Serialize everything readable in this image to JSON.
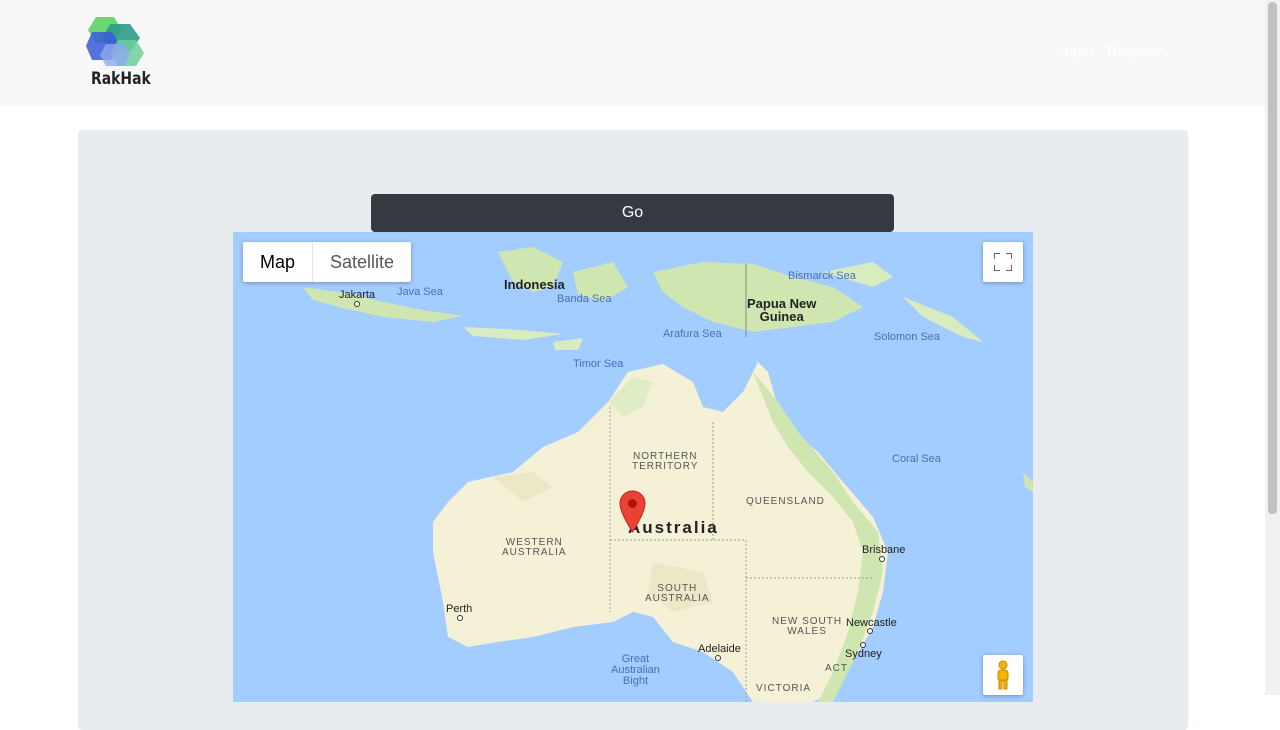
{
  "header": {
    "logo_text": "RakHak",
    "nav": {
      "login": "Login",
      "register": "Register"
    }
  },
  "form": {
    "go_label": "Go"
  },
  "map": {
    "type_controls": {
      "map": "Map",
      "satellite": "Satellite"
    },
    "labels": {
      "indonesia": "Indonesia",
      "jakarta": "Jakarta",
      "java_sea": "Java Sea",
      "banda_sea": "Banda Sea",
      "bismarck_sea": "Bismarck Sea",
      "png_line1": "Papua New",
      "png_line2": "Guinea",
      "arafura_sea": "Arafura Sea",
      "solomon_sea": "Solomon Sea",
      "timor_sea": "Timor Sea",
      "nt_line1": "NORTHERN",
      "nt_line2": "TERRITORY",
      "coral_sea": "Coral Sea",
      "queensland": "QUEENSLAND",
      "australia": "Australia",
      "wa_line1": "WESTERN",
      "wa_line2": "AUSTRALIA",
      "brisbane": "Brisbane",
      "sa_line1": "SOUTH",
      "sa_line2": "AUSTRALIA",
      "perth": "Perth",
      "nsw_line1": "NEW SOUTH",
      "nsw_line2": "WALES",
      "newcastle": "Newcastle",
      "adelaide": "Adelaide",
      "sydney": "Sydney",
      "gab_line1": "Great",
      "gab_line2": "Australian",
      "gab_line3": "Bight",
      "act": "ACT",
      "victoria": "VICTORIA"
    },
    "colors": {
      "water": "#a3ccff",
      "land": "#f5f1d7",
      "green": "#cfe6b0",
      "marker": "#ea4335"
    }
  }
}
